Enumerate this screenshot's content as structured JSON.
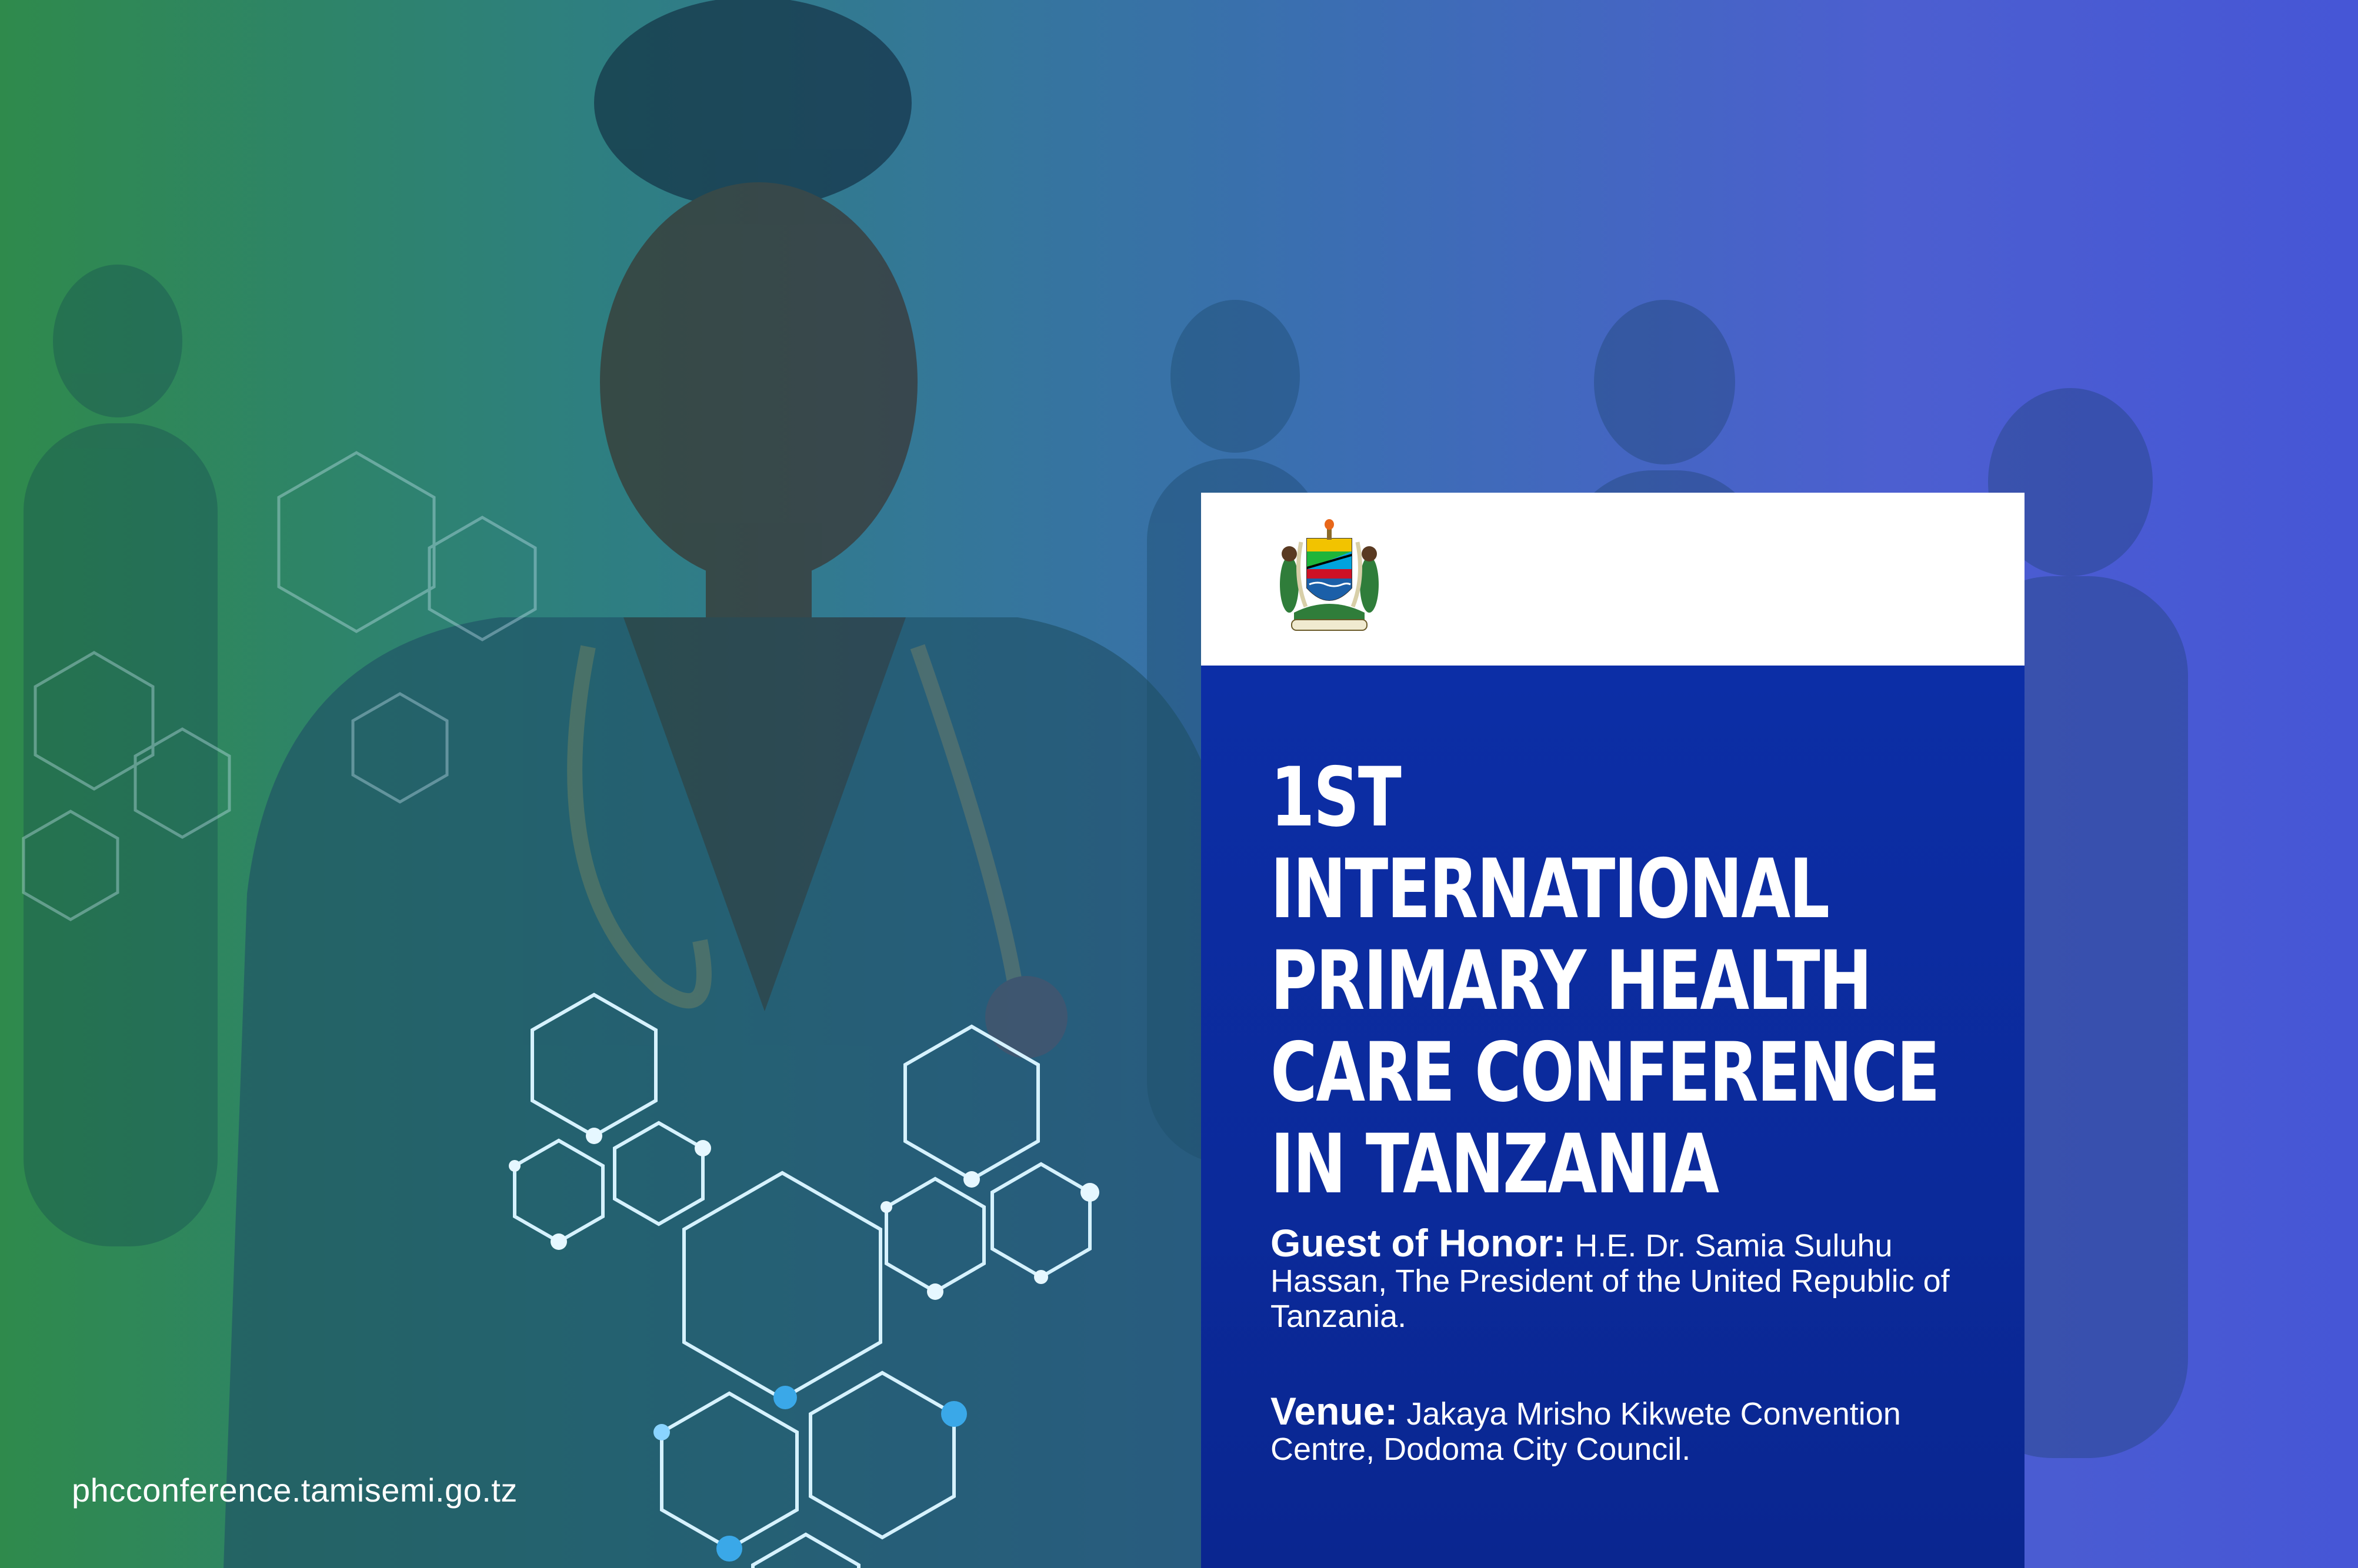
{
  "poster": {
    "title_lines": [
      "1ST",
      "INTERNATIONAL",
      "PRIMARY HEALTH",
      "CARE CONFERENCE",
      "IN TANZANIA"
    ],
    "guest_label": "Guest of Honor:",
    "guest_text": "H.E. Dr. Samia Suluhu Hassan, The President of the United Republic of Tanzania.",
    "venue_label": "Venue:",
    "venue_text": "Jakaya Mrisho Kikwete Convention Centre, Dodoma City Council.",
    "website": "phcconference.tamisemi.go.tz"
  },
  "colors": {
    "gradient_left": "#2f8a4c",
    "gradient_right": "#4656d6",
    "panel_blue": "#0c2ea6",
    "header_white": "#ffffff",
    "hex_line": "#d6f2ff",
    "hex_node": "#3aa8e8"
  },
  "icons": {
    "emblem": "tanzania-coat-of-arms-icon"
  }
}
